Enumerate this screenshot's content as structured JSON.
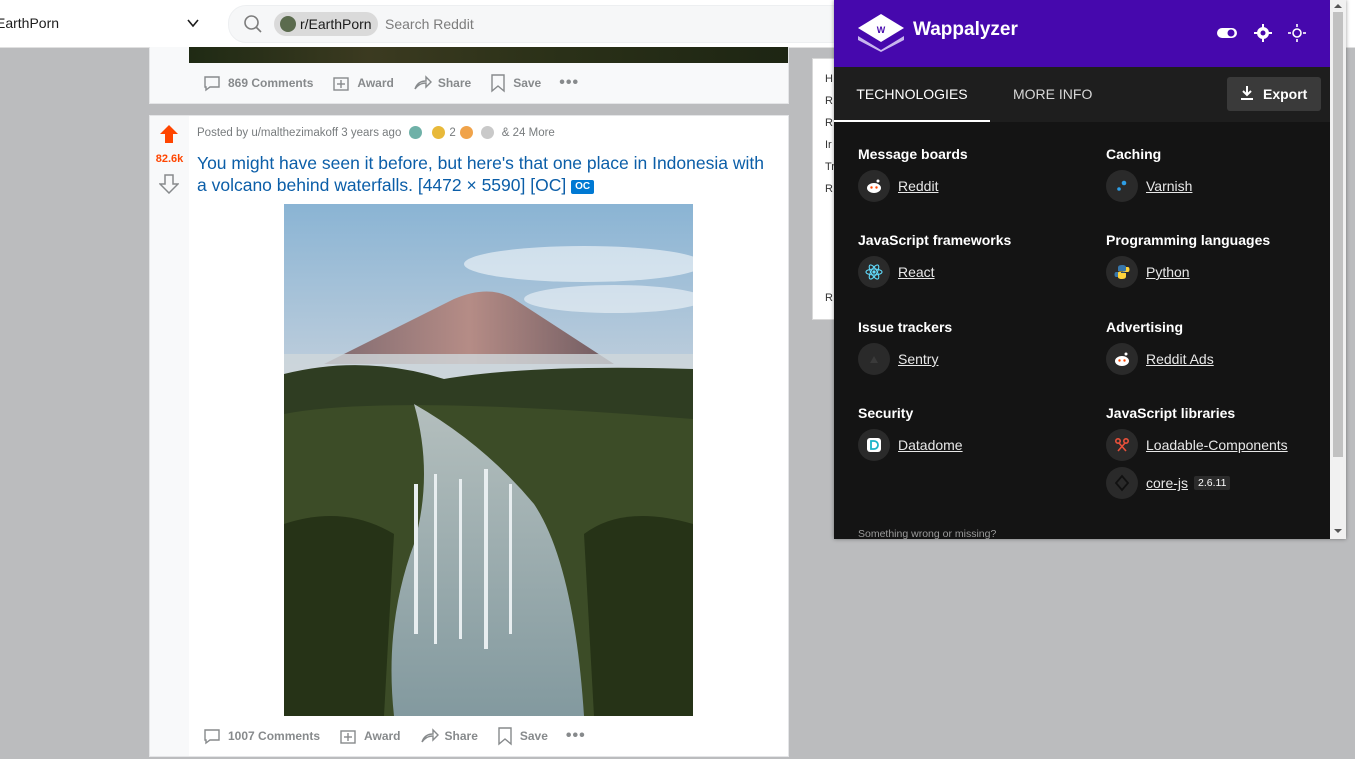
{
  "header": {
    "subreddit_switcher": "EarthPorn",
    "search_chip": "r/EarthPorn",
    "search_placeholder": "Search Reddit"
  },
  "prev_post": {
    "comments": "869 Comments",
    "award": "Award",
    "share": "Share",
    "save": "Save"
  },
  "post": {
    "score": "82.6k",
    "posted_by": "Posted by u/malthezimakoff 3 years ago",
    "award_count": "2",
    "more_awards": "& 24 More",
    "title": "You might have seen it before, but here's that one place in Indonesia with a volcano behind waterfalls. [4472 × 5590] [OC]",
    "flair": "OC",
    "comments": "1007 Comments",
    "award": "Award",
    "share": "Share",
    "save": "Save"
  },
  "sidebar_letters": [
    "H",
    "R",
    "R",
    "Ir",
    "Tr",
    "R",
    "R"
  ],
  "wappalyzer": {
    "brand": "Wappalyzer",
    "tabs": [
      "TECHNOLOGIES",
      "MORE INFO"
    ],
    "export": "Export",
    "categories": [
      {
        "name": "Message boards",
        "techs": [
          {
            "name": "Reddit",
            "icon": "reddit-icon"
          }
        ]
      },
      {
        "name": "Caching",
        "techs": [
          {
            "name": "Varnish",
            "icon": "varnish-icon"
          }
        ]
      },
      {
        "name": "JavaScript frameworks",
        "techs": [
          {
            "name": "React",
            "icon": "react-icon"
          }
        ]
      },
      {
        "name": "Programming languages",
        "techs": [
          {
            "name": "Python",
            "icon": "python-icon"
          }
        ]
      },
      {
        "name": "Issue trackers",
        "techs": [
          {
            "name": "Sentry",
            "icon": "sentry-icon"
          }
        ]
      },
      {
        "name": "Advertising",
        "techs": [
          {
            "name": "Reddit Ads",
            "icon": "reddit-ads-icon"
          }
        ]
      },
      {
        "name": "Security",
        "techs": [
          {
            "name": "Datadome",
            "icon": "datadome-icon"
          }
        ]
      },
      {
        "name": "JavaScript libraries",
        "techs": [
          {
            "name": "Loadable-Components",
            "icon": "loadable-icon"
          },
          {
            "name": "core-js",
            "version": "2.6.11",
            "icon": "corejs-icon"
          }
        ]
      }
    ],
    "footer": "Something wrong or missing?"
  },
  "colors": {
    "wappalyzer_purple": "#4608ad",
    "reddit_orange": "#ff4500",
    "link_blue": "#0b5ea8"
  }
}
